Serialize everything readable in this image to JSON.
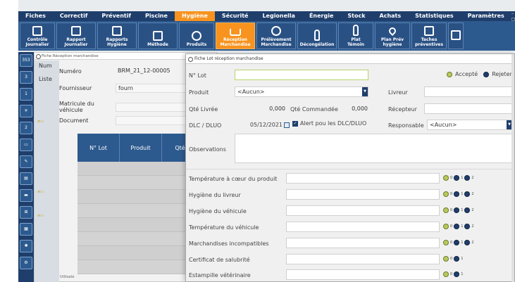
{
  "menu": {
    "items": [
      "Fiches",
      "Correctif",
      "Préventif",
      "Piscine",
      "Hygiène",
      "Sécurité",
      "Legionella",
      "Énergie",
      "Stock",
      "Achats",
      "Statistiques",
      "Paramètres"
    ],
    "active": "Hygiène"
  },
  "toolbar": [
    {
      "l1": "Contrôle",
      "l2": "Journalier",
      "icon": "checklist-icon"
    },
    {
      "l1": "Rapport",
      "l2": "Journalier",
      "icon": "report-icon"
    },
    {
      "l1": "Rapports",
      "l2": "Hygiène",
      "icon": "clipboard-icon"
    },
    {
      "l1": "Méthode",
      "l2": "",
      "icon": "book-icon"
    },
    {
      "l1": "Produits",
      "l2": "",
      "icon": "food-icon"
    },
    {
      "l1": "Réception",
      "l2": "Marchandise",
      "icon": "cart-icon",
      "active": true
    },
    {
      "l1": "Prélèvement",
      "l2": "Marchandise",
      "icon": "sample-icon"
    },
    {
      "l1": "Décongélation",
      "l2": "",
      "icon": "thermometer-icon"
    },
    {
      "l1": "Plat",
      "l2": "Témoin",
      "icon": "plate-icon"
    },
    {
      "l1": "Plan Prév",
      "l2": "hygiène",
      "icon": "map-pin-icon"
    },
    {
      "l1": "Taches",
      "l2": "préventives",
      "icon": "tasks-icon"
    }
  ],
  "sidebar": {
    "badge_353": "353",
    "badge_3": "3",
    "badge_1": "1",
    "badge_2": "2"
  },
  "bg_window": {
    "title": "Fiche Réception marchandise",
    "side_num": "Num",
    "side_liste": "Liste",
    "numero_label": "Numéro",
    "numero_value": "BRM_21_12-00005",
    "fournisseur_label": "Fournisseur",
    "fournisseur_value": "fourn",
    "matricule_label": "Matricule du véhicule",
    "document_label": "Document",
    "col_lot": "N° Lot",
    "col_produit": "Produit",
    "col_qte": "Qté Livrée",
    "footer": "Utilisate"
  },
  "dialog": {
    "title": "Fiche Lot réception marchandise",
    "lot_label": "N° Lot",
    "lot_value": "",
    "accepte_label": "Accepté",
    "rejeter_label": "Rejeter",
    "produit_label": "Produit",
    "produit_value": "<Aucun>",
    "livreur_label": "Livreur",
    "qte_livree_label": "Qté Livrée",
    "qte_livree_value": "0,000",
    "qte_cmd_label": "Qté Commandée",
    "qte_cmd_value": "0,000",
    "recepteur_label": "Récepteur",
    "dlc_label": "DLC / DLUO",
    "dlc_value": "05/12/2021",
    "alert_label": "Alert pou les DLC/DLUO",
    "responsable_label": "Responsable",
    "responsable_value": "<Aucun>",
    "observations_label": "Observations",
    "checks": [
      {
        "label": "Température à cœur du produit",
        "options": [
          "0",
          "1",
          "2"
        ]
      },
      {
        "label": "Hygiène du livreur",
        "options": [
          "0",
          "1",
          "2"
        ]
      },
      {
        "label": "Hygiène du véhicule",
        "options": [
          "0",
          "1",
          "2"
        ]
      },
      {
        "label": "Température du véhicule",
        "options": [
          "0",
          "1",
          "2"
        ]
      },
      {
        "label": "Marchandises incompatibles",
        "options": [
          "0",
          "1",
          "2"
        ]
      },
      {
        "label": "Certificat de salubrité",
        "options": [
          "0",
          "1"
        ]
      },
      {
        "label": "Estampille vétérinaire",
        "options": [
          "0",
          "1"
        ]
      }
    ]
  }
}
